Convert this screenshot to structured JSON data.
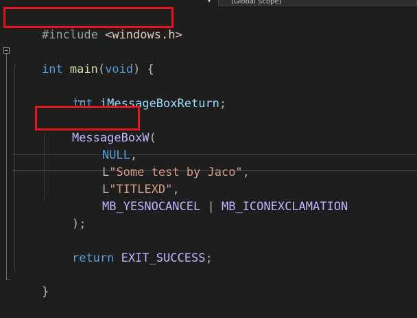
{
  "topbar": {
    "scope_label": "(Global Scope)"
  },
  "code": {
    "include_kw": "#include",
    "include_file": "<windows.h>",
    "main_int": "int",
    "main_name": "main",
    "main_open": "(",
    "main_void": "void",
    "main_close": ") {",
    "decl_int": "int",
    "decl_var": "iMessageBoxReturn",
    "decl_semi": ";",
    "call_fn": "MessageBoxW",
    "call_paren": "(",
    "arg1": "NULL",
    "comma": ",",
    "arg2_prefix": "L",
    "arg2": "\"Some test by Jaco\"",
    "arg3_prefix": "L",
    "arg3": "\"TITLEXD\"",
    "arg4_a": "MB_YESNOCANCEL",
    "arg4_pipe": " | ",
    "arg4_b": "MB_ICONEXCLAMATION",
    "call_close": ");",
    "return_kw": "return",
    "return_val": "EXIT_SUCCESS",
    "return_semi": ";",
    "close_brace": "}"
  }
}
